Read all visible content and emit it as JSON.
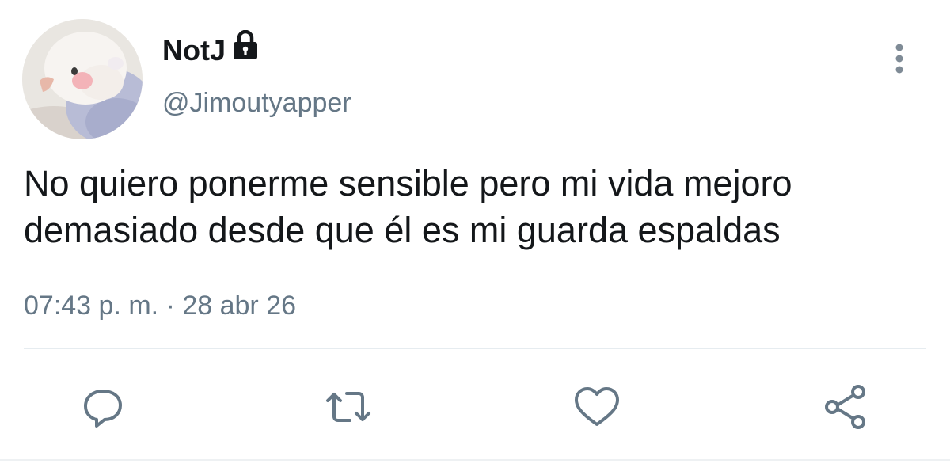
{
  "tweet": {
    "display_name": "NotJ",
    "handle": "@Jimoutyapper",
    "text": "No quiero ponerme sensible pero mi vida mejoro\ndemasiado desde que él es mi guarda espaldas",
    "time": "07:43 p. m.",
    "separator": "·",
    "date": "28 abr 26",
    "protected": true
  },
  "icons": {
    "lock": "lock-icon",
    "more": "more-vertical-icon",
    "reply": "reply-icon",
    "retweet": "retweet-icon",
    "like": "heart-icon",
    "share": "share-icon"
  },
  "colors": {
    "text": "#14171a",
    "secondary": "#657786",
    "divider": "#e6ecf0"
  }
}
